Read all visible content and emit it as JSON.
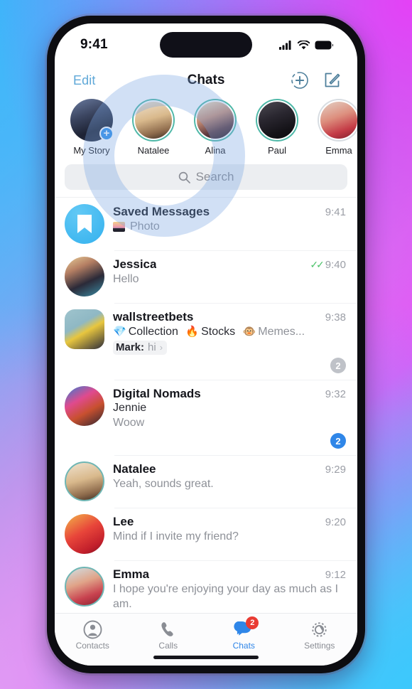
{
  "theme": {
    "accent": "#2f86e8",
    "link": "#5fa8d8",
    "story_unseen_ring": "#4fb8a8",
    "story_seen_ring": "#d8dde2",
    "badge_blue": "#2f86e8",
    "badge_muted": "#bfc2c8",
    "badge_red": "#e93b33",
    "tick_green": "#4cc26a",
    "wallpaper_top_left": "#4dc6f5",
    "wallpaper_top_right": "#e93cf7",
    "wallpaper_bottom_left": "#e2a0f4",
    "wallpaper_bottom_right": "#3cc8fc"
  },
  "status_bar": {
    "time": "9:41",
    "cellular_icon": "cellular-bars-icon",
    "wifi_icon": "wifi-icon",
    "battery_icon": "battery-full-icon"
  },
  "nav": {
    "edit_label": "Edit",
    "title": "Chats",
    "add_story_icon": "add-story-circle-plus-icon",
    "compose_icon": "compose-pencil-square-icon"
  },
  "stories": [
    {
      "name": "My Story",
      "state": "mine",
      "has_plus": true,
      "plus_glyph": "+"
    },
    {
      "name": "Natalee",
      "state": "unseen",
      "has_plus": false
    },
    {
      "name": "Alina",
      "state": "unseen",
      "has_plus": false
    },
    {
      "name": "Paul",
      "state": "unseen",
      "has_plus": false
    },
    {
      "name": "Emma",
      "state": "seen",
      "has_plus": false
    }
  ],
  "search": {
    "placeholder": "Search",
    "value": "",
    "icon": "search-magnifier-icon"
  },
  "chats": [
    {
      "title": "Saved Messages",
      "time": "9:41",
      "preview": "Photo",
      "preview_has_photo_thumb": true,
      "avatar_kind": "saved-bookmark",
      "read_ticks": false,
      "badge": null
    },
    {
      "title": "Jessica",
      "time": "9:40",
      "preview": "Hello",
      "preview_has_photo_thumb": false,
      "avatar_kind": "photo",
      "read_ticks": true,
      "badge": null
    },
    {
      "title": "wallstreetbets",
      "time": "9:38",
      "preview_rich": [
        {
          "emoji": "💎",
          "text": "Collection"
        },
        {
          "emoji": "🔥",
          "text": "Stocks"
        },
        {
          "emoji": "🐵",
          "text": "Memes..."
        }
      ],
      "pinned": {
        "name": "Mark:",
        "text": "hi",
        "chevron": "›"
      },
      "avatar_kind": "square-photo",
      "read_ticks": false,
      "badge": {
        "count": "2",
        "style": "muted"
      }
    },
    {
      "title": "Digital Nomads",
      "time": "9:32",
      "sender": "Jennie",
      "preview": "Woow",
      "preview_has_photo_thumb": false,
      "avatar_kind": "photo",
      "read_ticks": false,
      "badge": {
        "count": "2",
        "style": "blue"
      }
    },
    {
      "title": "Natalee",
      "time": "9:29",
      "preview": "Yeah, sounds great.",
      "preview_has_photo_thumb": false,
      "avatar_kind": "photo-ringed",
      "read_ticks": false,
      "badge": null
    },
    {
      "title": "Lee",
      "time": "9:20",
      "preview": "Mind if I invite my friend?",
      "preview_has_photo_thumb": false,
      "avatar_kind": "photo",
      "read_ticks": false,
      "badge": null
    },
    {
      "title": "Emma",
      "time": "9:12",
      "preview": "I hope you're enjoying your day as much as I am.",
      "preview_has_photo_thumb": false,
      "avatar_kind": "photo-ringed",
      "read_ticks": false,
      "badge": null
    }
  ],
  "tabs": [
    {
      "label": "Contacts",
      "icon": "contacts-person-icon",
      "active": false,
      "badge": null
    },
    {
      "label": "Calls",
      "icon": "phone-handset-icon",
      "active": false,
      "badge": null
    },
    {
      "label": "Chats",
      "icon": "chat-bubbles-icon",
      "active": true,
      "badge": "2"
    },
    {
      "label": "Settings",
      "icon": "gear-settings-icon",
      "active": false,
      "badge": null
    }
  ]
}
